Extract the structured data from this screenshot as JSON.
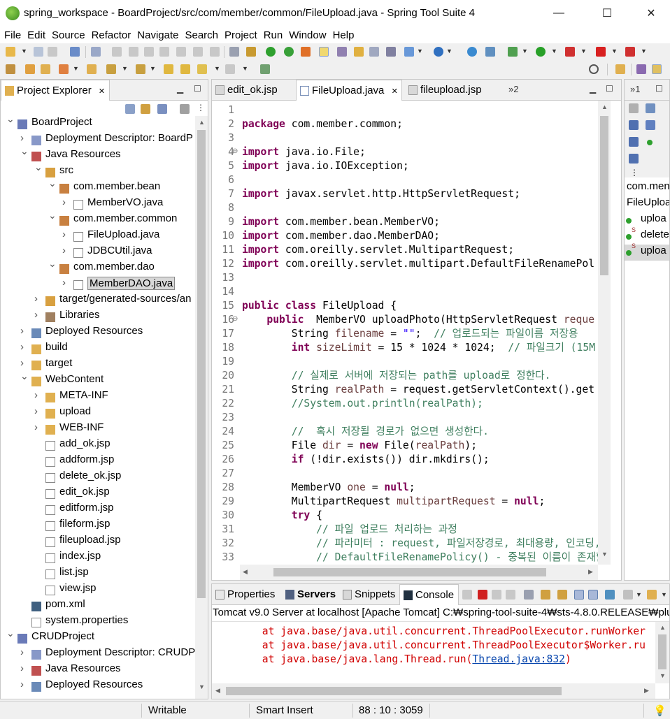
{
  "window": {
    "title": "spring_workspace - BoardProject/src/com/member/common/FileUpload.java - Spring Tool Suite 4",
    "minimize": "—",
    "maximize": "☐",
    "close": "✕"
  },
  "menu": [
    "File",
    "Edit",
    "Source",
    "Refactor",
    "Navigate",
    "Search",
    "Project",
    "Run",
    "Window",
    "Help"
  ],
  "explorer": {
    "tab_label": "Project Explorer",
    "close": "✕",
    "items": [
      {
        "label": "BoardProject",
        "indent": 0,
        "arrow": "⌄",
        "icon": "project-icon"
      },
      {
        "label": "Deployment Descriptor: BoardP",
        "indent": 1,
        "arrow": "›",
        "icon": "descriptor-icon"
      },
      {
        "label": "Java Resources",
        "indent": 1,
        "arrow": "⌄",
        "icon": "java-resources-icon"
      },
      {
        "label": "src",
        "indent": 2,
        "arrow": "⌄",
        "icon": "source-folder-icon"
      },
      {
        "label": "com.member.bean",
        "indent": 3,
        "arrow": "⌄",
        "icon": "package-icon"
      },
      {
        "label": "MemberVO.java",
        "indent": 4,
        "arrow": "›",
        "icon": "java-file-icon"
      },
      {
        "label": "com.member.common",
        "indent": 3,
        "arrow": "⌄",
        "icon": "package-icon"
      },
      {
        "label": "FileUpload.java",
        "indent": 4,
        "arrow": "›",
        "icon": "java-file-icon"
      },
      {
        "label": "JDBCUtil.java",
        "indent": 4,
        "arrow": "›",
        "icon": "java-file-icon"
      },
      {
        "label": "com.member.dao",
        "indent": 3,
        "arrow": "⌄",
        "icon": "package-icon"
      },
      {
        "label": "MemberDAO.java",
        "indent": 4,
        "arrow": "›",
        "icon": "java-file-icon",
        "selected": true
      },
      {
        "label": "target/generated-sources/an",
        "indent": 2,
        "arrow": "›",
        "icon": "source-folder-icon"
      },
      {
        "label": "Libraries",
        "indent": 2,
        "arrow": "›",
        "icon": "library-icon"
      },
      {
        "label": "Deployed Resources",
        "indent": 1,
        "arrow": "›",
        "icon": "deployed-icon"
      },
      {
        "label": "build",
        "indent": 1,
        "arrow": "›",
        "icon": "folder-icon"
      },
      {
        "label": "target",
        "indent": 1,
        "arrow": "›",
        "icon": "folder-icon"
      },
      {
        "label": "WebContent",
        "indent": 1,
        "arrow": "⌄",
        "icon": "folder-icon"
      },
      {
        "label": "META-INF",
        "indent": 2,
        "arrow": "›",
        "icon": "folder-icon"
      },
      {
        "label": "upload",
        "indent": 2,
        "arrow": "›",
        "icon": "folder-icon"
      },
      {
        "label": "WEB-INF",
        "indent": 2,
        "arrow": "›",
        "icon": "folder-icon"
      },
      {
        "label": "add_ok.jsp",
        "indent": 2,
        "arrow": "",
        "icon": "jsp-file-icon"
      },
      {
        "label": "addform.jsp",
        "indent": 2,
        "arrow": "",
        "icon": "jsp-file-icon"
      },
      {
        "label": "delete_ok.jsp",
        "indent": 2,
        "arrow": "",
        "icon": "jsp-file-icon"
      },
      {
        "label": "edit_ok.jsp",
        "indent": 2,
        "arrow": "",
        "icon": "jsp-file-icon"
      },
      {
        "label": "editform.jsp",
        "indent": 2,
        "arrow": "",
        "icon": "jsp-file-icon"
      },
      {
        "label": "fileform.jsp",
        "indent": 2,
        "arrow": "",
        "icon": "jsp-file-icon"
      },
      {
        "label": "fileupload.jsp",
        "indent": 2,
        "arrow": "",
        "icon": "jsp-file-icon"
      },
      {
        "label": "index.jsp",
        "indent": 2,
        "arrow": "",
        "icon": "jsp-file-icon"
      },
      {
        "label": "list.jsp",
        "indent": 2,
        "arrow": "",
        "icon": "jsp-file-icon"
      },
      {
        "label": "view.jsp",
        "indent": 2,
        "arrow": "",
        "icon": "jsp-file-icon"
      },
      {
        "label": "pom.xml",
        "indent": 1,
        "arrow": "",
        "icon": "maven-file-icon"
      },
      {
        "label": "system.properties",
        "indent": 1,
        "arrow": "",
        "icon": "text-file-icon"
      },
      {
        "label": "CRUDProject",
        "indent": 0,
        "arrow": "⌄",
        "icon": "project-icon"
      },
      {
        "label": "Deployment Descriptor: CRUDP",
        "indent": 1,
        "arrow": "›",
        "icon": "descriptor-icon"
      },
      {
        "label": "Java Resources",
        "indent": 1,
        "arrow": "›",
        "icon": "java-resources-icon"
      },
      {
        "label": "Deployed Resources",
        "indent": 1,
        "arrow": "›",
        "icon": "deployed-icon"
      }
    ]
  },
  "editor": {
    "tabs": [
      {
        "label": "edit_ok.jsp",
        "active": false
      },
      {
        "label": "FileUpload.java",
        "active": true
      },
      {
        "label": "fileupload.jsp",
        "active": false
      }
    ],
    "tab_close": "✕",
    "overflow": "»2",
    "lines": [
      {
        "n": "1",
        "t": ""
      },
      {
        "n": "2",
        "t": "package com.member.common;"
      },
      {
        "n": "3",
        "t": ""
      },
      {
        "n": "4",
        "t": "import java.io.File;",
        "fold": true
      },
      {
        "n": "5",
        "t": "import java.io.IOException;"
      },
      {
        "n": "6",
        "t": ""
      },
      {
        "n": "7",
        "t": "import javax.servlet.http.HttpServletRequest;"
      },
      {
        "n": "8",
        "t": ""
      },
      {
        "n": "9",
        "t": "import com.member.bean.MemberVO;"
      },
      {
        "n": "10",
        "t": "import com.member.dao.MemberDAO;"
      },
      {
        "n": "11",
        "t": "import com.oreilly.servlet.MultipartRequest;"
      },
      {
        "n": "12",
        "t": "import com.oreilly.servlet.multipart.DefaultFileRenamePol"
      },
      {
        "n": "13",
        "t": ""
      },
      {
        "n": "14",
        "t": ""
      },
      {
        "n": "15",
        "t": "public class FileUpload {"
      },
      {
        "n": "16",
        "t": "    public  MemberVO uploadPhoto(HttpServletRequest reque",
        "fold": true
      },
      {
        "n": "17",
        "t": "        String filename = \"\";  // 업로드되는 파일이름 저장용"
      },
      {
        "n": "18",
        "t": "        int sizeLimit = 15 * 1024 * 1024;  // 파일크기 (15M"
      },
      {
        "n": "19",
        "t": ""
      },
      {
        "n": "20",
        "t": "        // 실제로 서버에 저장되는 path를 upload로 정한다."
      },
      {
        "n": "21",
        "t": "        String realPath = request.getServletContext().get"
      },
      {
        "n": "22",
        "t": "        //System.out.println(realPath);"
      },
      {
        "n": "23",
        "t": ""
      },
      {
        "n": "24",
        "t": "        //  혹시 저장될 경로가 없으면 생성한다."
      },
      {
        "n": "25",
        "t": "        File dir = new File(realPath);"
      },
      {
        "n": "26",
        "t": "        if (!dir.exists()) dir.mkdirs();"
      },
      {
        "n": "27",
        "t": ""
      },
      {
        "n": "28",
        "t": "        MemberVO one = null;"
      },
      {
        "n": "29",
        "t": "        MultipartRequest multipartRequest = null;"
      },
      {
        "n": "30",
        "t": "        try {"
      },
      {
        "n": "31",
        "t": "            // 파일 업로드 처리하는 과정"
      },
      {
        "n": "32",
        "t": "            // 파라미터 : request, 파일저장경로, 최대용량, 인코딩, 중"
      },
      {
        "n": "33",
        "t": "            // DefaultFileRenamePolicy() - 중복된 이름이 존재할"
      }
    ]
  },
  "outline": {
    "overflow": "»1",
    "package": "com.men",
    "class": "FileUpload",
    "members": [
      "uploa",
      "delete",
      "uploa"
    ]
  },
  "console": {
    "tabs": [
      "Properties",
      "Servers",
      "Snippets",
      "Console"
    ],
    "header": "Tomcat v9.0 Server at localhost [Apache Tomcat] C:₩spring-tool-suite-4₩sts-4.8.0.RELEASE₩plug",
    "lines": [
      {
        "pre": "        at java.base/java.util.concurrent.ThreadPoolExecutor.runWorker",
        "link": "",
        "post": ""
      },
      {
        "pre": "        at java.base/java.util.concurrent.ThreadPoolExecutor$Worker.ru",
        "link": "",
        "post": ""
      },
      {
        "pre": "        at java.base/java.lang.Thread.run(",
        "link": "Thread.java:832",
        "post": ")"
      }
    ]
  },
  "status": {
    "writable": "Writable",
    "insert_mode": "Smart Insert",
    "position": "88 : 10 : 3059"
  }
}
